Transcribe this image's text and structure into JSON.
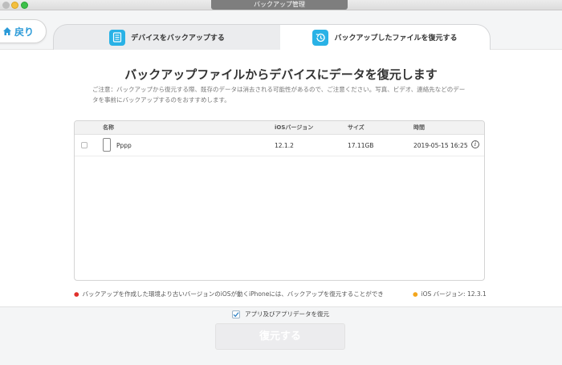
{
  "window": {
    "title": "バックアップ管理"
  },
  "nav": {
    "back_label": "戻り"
  },
  "tabs": [
    {
      "label": "デバイスをバックアップする"
    },
    {
      "label": "バックアップしたファイルを復元する"
    }
  ],
  "main": {
    "heading": "バックアップファイルからデバイスにデータを復元します",
    "notice": "ご注意：バックアップから復元する際、既存のデータは消去される可能性があるので、ご注意ください。写真、ビデオ、連絡先などのデータを事前にバックアップするのをおすすめします。"
  },
  "table": {
    "columns": [
      "名称",
      "iOSバージョン",
      "サイズ",
      "時間"
    ],
    "rows": [
      {
        "name": "Pppp",
        "ios_version": "12.1.2",
        "size": "17.11GB",
        "time": "2019-05-15 16:25",
        "info": "i"
      }
    ]
  },
  "footer": {
    "warning": "バックアップを作成した環境より古いバージョンのiOSが動くiPhoneには、バックアップを復元することができ",
    "version": "iOS バージョン: 12.3.1",
    "restore_app_label": "アプリ及びアプリデータを復元",
    "restore_button": "復元する"
  },
  "colors": {
    "accent": "#29b2e6",
    "link": "#2a9ad8",
    "warning_dot": "#e0302b",
    "version_dot": "#f3a61d"
  }
}
